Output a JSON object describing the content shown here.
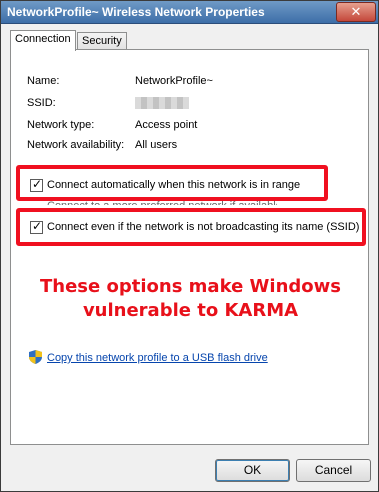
{
  "window": {
    "title": "NetworkProfile~ Wireless Network Properties",
    "close_glyph": "✕"
  },
  "tabs": [
    {
      "label": "Connection",
      "active": true
    },
    {
      "label": "Security",
      "active": false
    }
  ],
  "details": [
    {
      "label": "Name:",
      "value": "NetworkProfile~"
    },
    {
      "label": "SSID:",
      "value": ""
    },
    {
      "label": "Network type:",
      "value": "Access point"
    },
    {
      "label": "Network availability:",
      "value": "All users"
    }
  ],
  "options": [
    {
      "label": "Connect automatically when this network is in range",
      "checked": true
    },
    {
      "label": "Connect to a more preferred network if available",
      "checked": false
    },
    {
      "label": "Connect even if the network is not broadcasting its name (SSID)",
      "checked": true
    }
  ],
  "annotation": {
    "line1": "These options make Windows",
    "line2": "vulnerable to KARMA",
    "color": "#e8101a"
  },
  "copy_link": "Copy this network profile to a USB flash drive",
  "buttons": {
    "ok": "OK",
    "cancel": "Cancel"
  },
  "colors": {
    "title_bar": "#3d6ea8",
    "highlight": "#f01020",
    "link": "#0645ad"
  }
}
